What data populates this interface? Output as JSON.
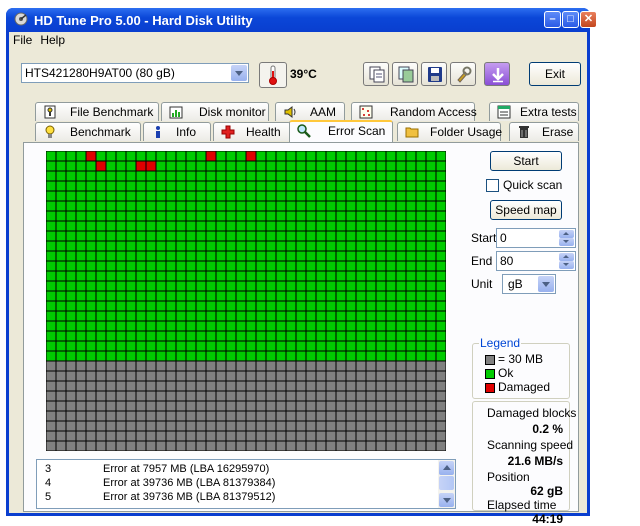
{
  "window": {
    "title": "HD Tune Pro 5.00 - Hard Disk Utility"
  },
  "menu": {
    "file": "File",
    "help": "Help"
  },
  "toolbar": {
    "drive": "HTS421280H9AT00 (80 gB)",
    "temperature": "39°C",
    "exit_label": "Exit",
    "tools": [
      "copy-text-icon",
      "copy-screen-icon",
      "save-icon",
      "options-icon",
      "download-icon"
    ]
  },
  "tabs": {
    "row1": [
      "File Benchmark",
      "Disk monitor",
      "AAM",
      "Random Access",
      "Extra tests"
    ],
    "row2": [
      "Benchmark",
      "Info",
      "Health",
      "Error Scan",
      "Folder Usage",
      "Erase"
    ],
    "active": "Error Scan"
  },
  "scan": {
    "start_label": "Start",
    "quick_scan_label": "Quick scan",
    "quick_scan_checked": false,
    "speed_map_label": "Speed map",
    "start_field_label": "Start",
    "start_value": "0",
    "end_field_label": "End",
    "end_value": "80",
    "unit_label": "Unit",
    "unit_value": "gB",
    "progress": 0.7,
    "grid_cols": 40,
    "grid_rows": 30,
    "damaged_blocks": [
      [
        4,
        0
      ],
      [
        16,
        0
      ],
      [
        5,
        1
      ],
      [
        9,
        1
      ],
      [
        10,
        1
      ],
      [
        20,
        0
      ]
    ]
  },
  "legend": {
    "title": "Legend",
    "block_size": "= 30 MB",
    "ok": "Ok",
    "damaged": "Damaged",
    "colors": {
      "unscanned": "#808080",
      "ok": "#00cc00",
      "damaged": "#e00000"
    }
  },
  "stats": {
    "damaged_blocks_label": "Damaged blocks",
    "damaged_blocks_value": "0.2 %",
    "scanning_speed_label": "Scanning speed",
    "scanning_speed_value": "21.6 MB/s",
    "position_label": "Position",
    "position_value": "62 gB",
    "elapsed_label": "Elapsed time",
    "elapsed_value": "44:19"
  },
  "log": [
    {
      "n": "3",
      "msg": "Error at 7957 MB (LBA 16295970)"
    },
    {
      "n": "4",
      "msg": "Error at 39736 MB (LBA 81379384)"
    },
    {
      "n": "5",
      "msg": "Error at 39736 MB (LBA 81379512)"
    }
  ]
}
